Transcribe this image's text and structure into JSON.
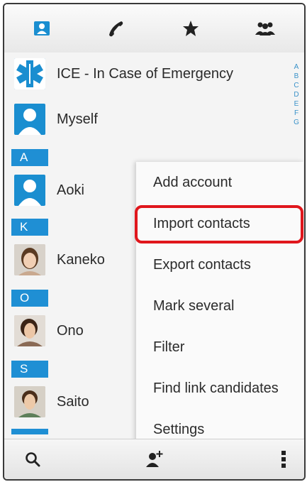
{
  "tabs": [
    {
      "icon": "contacts-card-icon",
      "active": true
    },
    {
      "icon": "phone-handset-icon",
      "active": false
    },
    {
      "icon": "star-icon",
      "active": false
    },
    {
      "icon": "groups-icon",
      "active": false
    }
  ],
  "contacts": {
    "ice": {
      "name": "ICE - In Case of Emergency"
    },
    "myself": {
      "name": "Myself"
    },
    "sections": [
      "A",
      "K",
      "O",
      "S"
    ],
    "rows": [
      {
        "name": "Aoki"
      },
      {
        "name": "Kaneko"
      },
      {
        "name": "Ono"
      },
      {
        "name": "Saito"
      }
    ]
  },
  "index_letters": [
    "A",
    "B",
    "C",
    "D",
    "E",
    "F",
    "G"
  ],
  "menu": {
    "items": [
      {
        "label": "Add account"
      },
      {
        "label": "Import contacts"
      },
      {
        "label": "Export contacts"
      },
      {
        "label": "Mark several"
      },
      {
        "label": "Filter"
      },
      {
        "label": "Find link candidates"
      },
      {
        "label": "Settings"
      }
    ],
    "highlighted": "Import contacts"
  },
  "colors": {
    "accent": "#1f8fd4",
    "highlight_border": "#e0161c"
  },
  "bottom_bar": {
    "icons": [
      "search-icon",
      "add-contact-icon",
      "overflow-menu-icon"
    ]
  }
}
